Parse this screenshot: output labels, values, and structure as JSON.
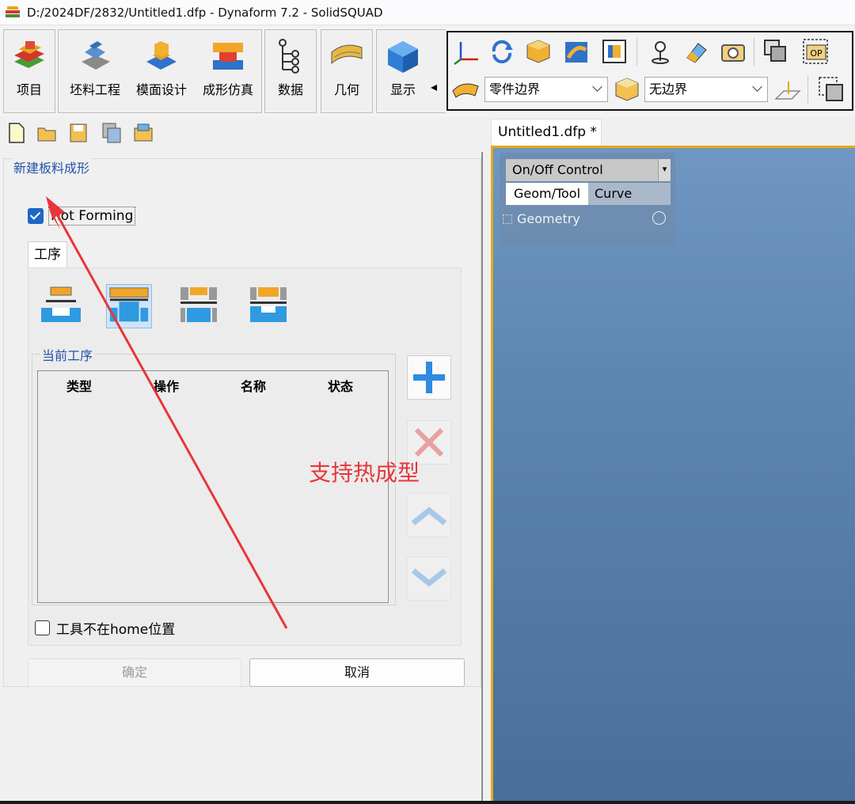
{
  "window": {
    "title": "D:/2024DF/2832/Untitled1.dfp - Dynaform 7.2  - SolidSQUAD"
  },
  "ribbon": {
    "buttons": [
      {
        "label": "项目",
        "icon": "project-icon"
      },
      {
        "label": "坯料工程",
        "icon": "blank-engineering-icon"
      },
      {
        "label": "模面设计",
        "icon": "die-face-design-icon"
      },
      {
        "label": "成形仿真",
        "icon": "forming-simulation-icon"
      },
      {
        "label": "数据",
        "icon": "data-tree-icon"
      },
      {
        "label": "几何",
        "icon": "geometry-icon"
      },
      {
        "label": "显示",
        "icon": "display-cube-icon"
      }
    ],
    "part_boundary_combo": "零件边界",
    "boundary_combo": "无边界",
    "collapse_arrow": "◂"
  },
  "left_panel": {
    "group_title": "新建板料成形",
    "hot_forming": {
      "label": "Hot Forming",
      "checked": true
    },
    "tab_label": "工序",
    "current_group_title": "当前工序",
    "columns": [
      "类型",
      "操作",
      "名称",
      "状态"
    ],
    "tool_not_home": {
      "label": "工具不在home位置",
      "checked": false
    },
    "ok_label": "确定",
    "cancel_label": "取消",
    "annotation": "支持热成型"
  },
  "document": {
    "tab_label": "Untitled1.dfp *",
    "onoff": {
      "header": "On/Off Control",
      "dropdown_glyph": "▾",
      "tab1": "Geom/Tool",
      "tab2": "Curve",
      "geometry": "Geometry"
    }
  },
  "colors": {
    "accent_blue": "#2452a8",
    "viewport_border": "#e6a81c",
    "annotation_red": "#e8363a",
    "viewport_bg": "#5e86b2"
  }
}
